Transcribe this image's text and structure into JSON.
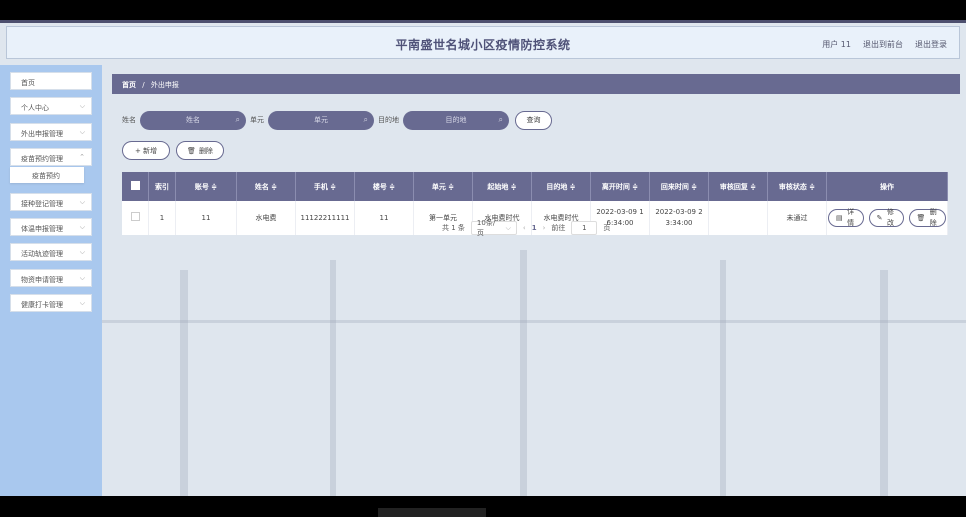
{
  "header": {
    "title": "平南盛世名城小区疫情防控系统",
    "user_label": "用户 11",
    "back_label": "退出到前台",
    "logout_label": "退出登录"
  },
  "sidebar": {
    "items": [
      {
        "label": "首页",
        "chevron": false
      },
      {
        "label": "个人中心",
        "chevron": true
      },
      {
        "label": "外出申报管理",
        "chevron": true
      },
      {
        "label": "疫苗预约管理",
        "chevron": true
      },
      {
        "label": "接种登记管理",
        "chevron": true
      },
      {
        "label": "体温申报管理",
        "chevron": true
      },
      {
        "label": "活动轨迹管理",
        "chevron": true
      },
      {
        "label": "物资申请管理",
        "chevron": true
      },
      {
        "label": "健康打卡管理",
        "chevron": true
      }
    ],
    "submenu_label": "疫苗预约"
  },
  "breadcrumb": {
    "home": "首页",
    "sep": "/",
    "current": "外出申报"
  },
  "search": {
    "name_label": "姓名",
    "name_placeholder": "姓名",
    "unit_label": "单元",
    "unit_placeholder": "单元",
    "dest_label": "目的地",
    "dest_placeholder": "目的地",
    "query_label": "查询"
  },
  "actions": {
    "add_label": "+ 新增",
    "delete_label": "删除"
  },
  "table": {
    "headers": [
      "索引",
      "账号 ≑",
      "姓名 ≑",
      "手机 ≑",
      "楼号 ≑",
      "单元 ≑",
      "起始地 ≑",
      "目的地 ≑",
      "离开时间 ≑",
      "回来时间 ≑",
      "审核回复 ≑",
      "审核状态 ≑",
      "操作"
    ],
    "rows": [
      {
        "index": "1",
        "account": "11",
        "name": "水电费",
        "phone": "11122211111",
        "building": "11",
        "unit": "第一单元",
        "origin": "水电费时代",
        "dest": "水电费时代",
        "leave_time": "2022-03-09 16:34:00",
        "return_time": "2022-03-09 23:34:00",
        "reply": "",
        "status": "未通过"
      }
    ],
    "op_detail": "详情",
    "op_edit": "修改",
    "op_delete": "删除"
  },
  "pager": {
    "total": "共 1 条",
    "page_size": "10条/页",
    "prev": "‹",
    "current": "1",
    "next": "›",
    "goto": "前往",
    "goto_value": "1",
    "page_unit": "页"
  }
}
